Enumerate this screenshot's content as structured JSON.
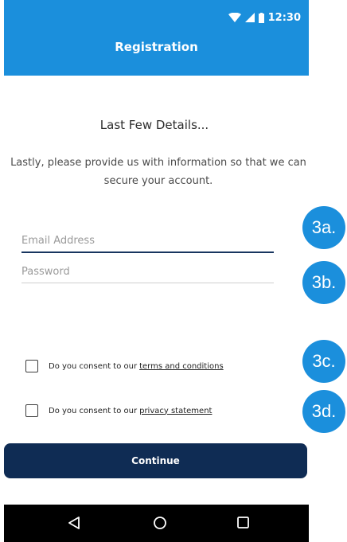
{
  "status_bar": {
    "time": "12:30",
    "icons": [
      "wifi-icon",
      "signal-icon",
      "battery-icon"
    ]
  },
  "header": {
    "title": "Registration"
  },
  "content": {
    "subtitle": "Last Few Details...",
    "description": "Lastly, please provide us with information so that we can secure your account."
  },
  "form": {
    "email_placeholder": "Email Address",
    "email_value": "",
    "password_placeholder": "Password",
    "password_value": "",
    "terms": {
      "prefix": "Do you consent to our",
      "link": "terms and conditions",
      "checked": false
    },
    "privacy": {
      "prefix": "Do you consent to our",
      "link": "privacy statement",
      "checked": false
    },
    "continue_label": "Continue"
  },
  "annotations": {
    "a": "3a.",
    "b": "3b.",
    "c": "3c.",
    "d": "3d."
  },
  "navbar": {
    "icons": [
      "back-icon",
      "home-icon",
      "recents-icon"
    ]
  },
  "colors": {
    "primary": "#1b8fdc",
    "dark_button": "#0f2c54",
    "email_underline": "#17355f"
  }
}
